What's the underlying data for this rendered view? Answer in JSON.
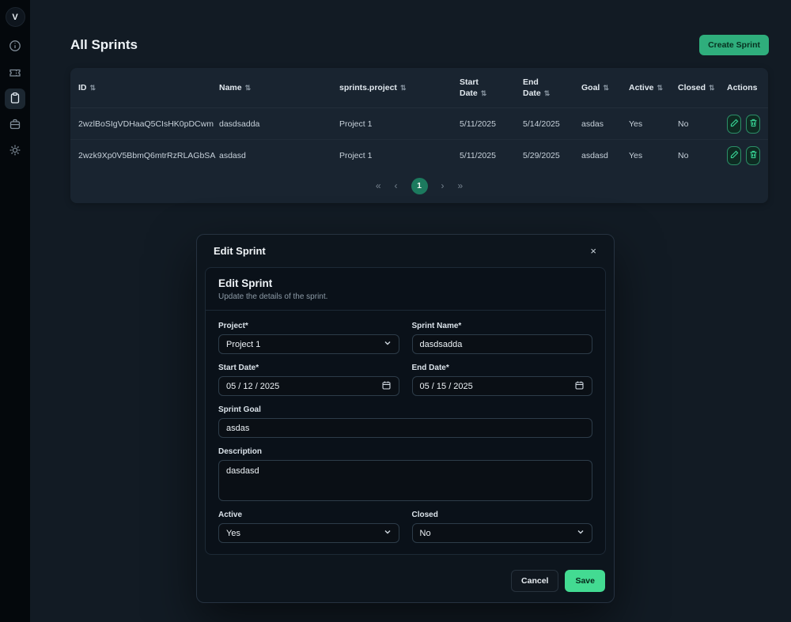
{
  "sidebar": {
    "logo": "V",
    "icons": [
      "info-icon",
      "ticket-icon",
      "clipboard-icon",
      "briefcase-icon",
      "gear-icon"
    ],
    "active_index": 2
  },
  "page": {
    "title": "All Sprints",
    "create_button_label": "Create Sprint"
  },
  "table": {
    "sort_glyph": "⇅",
    "columns": [
      {
        "label": "ID"
      },
      {
        "label": "Name"
      },
      {
        "label": "sprints.project"
      },
      {
        "label": "Start Date"
      },
      {
        "label": "End Date"
      },
      {
        "label": "Goal"
      },
      {
        "label": "Active"
      },
      {
        "label": "Closed"
      },
      {
        "label": "Actions"
      }
    ],
    "rows": [
      {
        "id": "2wzlBoSIgVDHaaQ5CIsHK0pDCwm",
        "name": "dasdsadda",
        "project": "Project 1",
        "start_date": "5/11/2025",
        "end_date": "5/14/2025",
        "goal": "asdas",
        "active": "Yes",
        "closed": "No"
      },
      {
        "id": "2wzk9Xp0V5BbmQ6mtrRzRLAGbSA",
        "name": "asdasd",
        "project": "Project 1",
        "start_date": "5/11/2025",
        "end_date": "5/29/2025",
        "goal": "asdasd",
        "active": "Yes",
        "closed": "No"
      }
    ],
    "pagination": {
      "first": "«",
      "prev": "‹",
      "current": "1",
      "next": "›",
      "last": "»"
    }
  },
  "modal": {
    "header_title": "Edit Sprint",
    "close_glyph": "×",
    "title": "Edit Sprint",
    "subtitle": "Update the details of the sprint.",
    "project": {
      "label": "Project*",
      "value": "Project 1"
    },
    "sprint_name": {
      "label": "Sprint Name*",
      "value": "dasdsadda"
    },
    "start_date": {
      "label": "Start Date*",
      "value": "05 / 12 / 2025"
    },
    "end_date": {
      "label": "End Date*",
      "value": "05 / 15 / 2025"
    },
    "sprint_goal": {
      "label": "Sprint Goal",
      "value": "asdas"
    },
    "description": {
      "label": "Description",
      "value": "dasdasd"
    },
    "active": {
      "label": "Active",
      "value": "Yes"
    },
    "closed": {
      "label": "Closed",
      "value": "No"
    },
    "cancel_label": "Cancel",
    "save_label": "Save"
  }
}
